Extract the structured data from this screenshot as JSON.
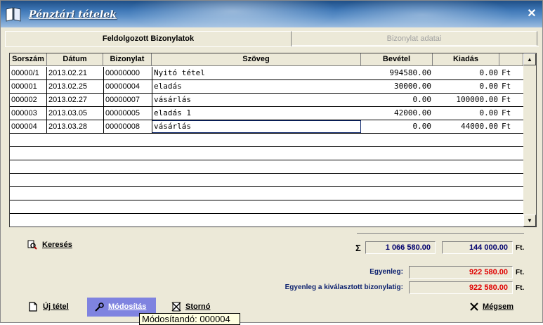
{
  "window": {
    "title": "Pénztári tételek",
    "close_label": "✕"
  },
  "tabs": [
    {
      "label": "Feldolgozott Bizonylatok",
      "active": true
    },
    {
      "label": "Bizonylat adatai",
      "active": false
    }
  ],
  "grid": {
    "headers": [
      "Sorszám",
      "Dátum",
      "Bizonylat",
      "Szöveg",
      "Bevétel",
      "Kiadás",
      ""
    ],
    "rows": [
      {
        "sorszam": "00000/1",
        "datum": "2013.02.21",
        "bizonylat": "00000000",
        "szoveg": "Nyitó tétel",
        "bevetel": "994580.00",
        "kiadas": "0.00",
        "penznem": "Ft"
      },
      {
        "sorszam": "000001",
        "datum": "2013.02.25",
        "bizonylat": "00000004",
        "szoveg": "eladás",
        "bevetel": "30000.00",
        "kiadas": "0.00",
        "penznem": "Ft"
      },
      {
        "sorszam": "000002",
        "datum": "2013.02.27",
        "bizonylat": "00000007",
        "szoveg": "vásárlás",
        "bevetel": "0.00",
        "kiadas": "100000.00",
        "penznem": "Ft"
      },
      {
        "sorszam": "000003",
        "datum": "2013.03.05",
        "bizonylat": "00000005",
        "szoveg": "eladás 1",
        "bevetel": "42000.00",
        "kiadas": "0.00",
        "penznem": "Ft"
      },
      {
        "sorszam": "000004",
        "datum": "2013.03.28",
        "bizonylat": "00000008",
        "szoveg": "vásárlás",
        "bevetel": "0.00",
        "kiadas": "44000.00",
        "penznem": "Ft"
      }
    ],
    "empty_rows": 7,
    "scroll_up": "▲",
    "scroll_down": "▼"
  },
  "search": {
    "label": "Keresés",
    "icon": "search-icon"
  },
  "totals": {
    "sigma": "Σ",
    "income": "1 066 580.00",
    "expense": "144 000.00",
    "currency": "Ft.",
    "income_color": "#00006e",
    "expense_color": "#00006e"
  },
  "balance": {
    "label": "Egyenleg:",
    "value": "922 580.00",
    "currency": "Ft.",
    "color": "#e00000"
  },
  "balance_selected": {
    "label": "Egyenleg a kiválasztott bizonylatig:",
    "value": "922 580.00",
    "currency": "Ft.",
    "color": "#e00000"
  },
  "buttons": {
    "new": "Új tétel",
    "modify": "Módosítás",
    "storno": "Stornó",
    "cancel": "Mégsem"
  },
  "tooltip": "Módosítandó: 000004"
}
